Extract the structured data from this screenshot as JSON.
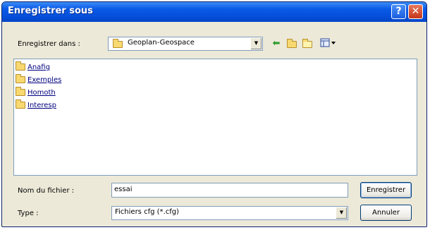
{
  "window": {
    "title": "Enregistrer sous",
    "help_glyph": "?",
    "close_glyph": "✕"
  },
  "location": {
    "label": "Enregistrer dans :",
    "value": "Geoplan-Geospace"
  },
  "toolbar": {
    "back_icon": "back-arrow-icon",
    "up_icon": "up-folder-icon",
    "new_folder_icon": "new-folder-icon",
    "view_icon": "view-menu-icon"
  },
  "files": [
    {
      "name": "Anafig"
    },
    {
      "name": "Exemples"
    },
    {
      "name": "Homoth"
    },
    {
      "name": "Interesp"
    }
  ],
  "filename": {
    "label": "Nom du fichier :",
    "value": "essai"
  },
  "filetype": {
    "label": "Type :",
    "value": "Fichiers cfg (*.cfg)"
  },
  "buttons": {
    "save": "Enregistrer",
    "cancel": "Annuler"
  }
}
